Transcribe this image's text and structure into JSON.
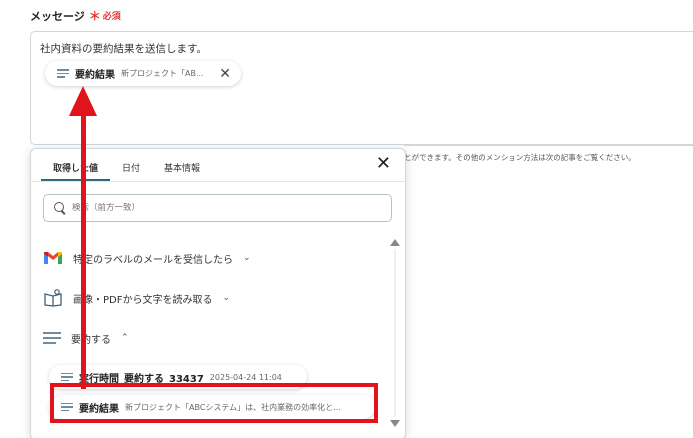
{
  "field": {
    "label": "メッセージ",
    "required_star": "＊",
    "required_text": "必須"
  },
  "message": {
    "text": "社内資料の要約結果を送信します。",
    "chip": {
      "name": "要約結果",
      "value": "新プロジェクト「AB...",
      "close": "✕"
    }
  },
  "help_text": "とができます。その他のメンション方法は次の記事をご覧ください。",
  "popup": {
    "tabs": [
      "取得した値",
      "日付",
      "基本情報"
    ],
    "close": "✕",
    "search_placeholder": "検索（前方一致）",
    "sections": [
      {
        "label": "特定のラベルのメールを受信したら",
        "chevron": "⌄",
        "icon": "gmail-icon"
      },
      {
        "label": "画像・PDFから文字を読み取る",
        "chevron": "⌄",
        "icon": "book-icon"
      },
      {
        "label": "要約する",
        "chevron": "⌃",
        "icon": "lines-icon"
      }
    ],
    "items": [
      {
        "name": "実行時間_要約する_33437",
        "value": "2025-04-24 11:04"
      },
      {
        "name": "要約結果",
        "value": "新プロジェクト「ABCシステム」は、社内業務の効率化と..."
      }
    ]
  },
  "colors": {
    "accent": "#e0141a",
    "required": "#e53935",
    "tab_underline": "#2e6a7a",
    "icon_lines": "#6e8ca0"
  }
}
